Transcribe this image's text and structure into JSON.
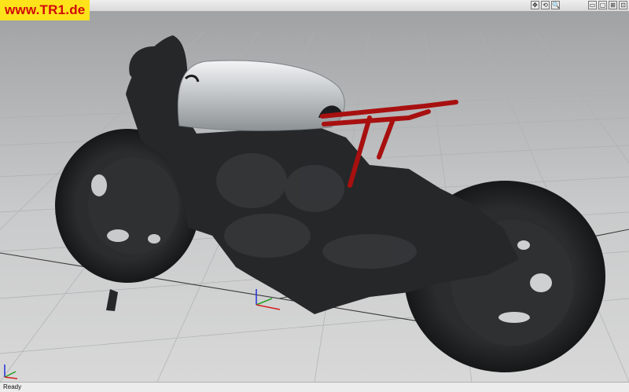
{
  "watermark": {
    "text": "www.TR1.de"
  },
  "toolbar": {
    "view_buttons": [
      {
        "icon": "pan-icon",
        "glyph": "✥"
      },
      {
        "icon": "rotate-icon",
        "glyph": "⟲"
      },
      {
        "icon": "zoom-icon",
        "glyph": "🔍"
      }
    ],
    "window_buttons": [
      {
        "icon": "minimize-icon",
        "glyph": "▭"
      },
      {
        "icon": "restore-icon",
        "glyph": "▢"
      },
      {
        "icon": "expand-icon",
        "glyph": "⊞"
      },
      {
        "icon": "grid-icon",
        "glyph": "⊡"
      }
    ]
  },
  "axis_gizmo": {
    "x_color": "#d42020",
    "y_color": "#22a022",
    "z_color": "#2030d8"
  },
  "statusbar": {
    "text": "Ready"
  },
  "colors": {
    "tank": "#c6cacd",
    "frame": "#b01212",
    "body": "#242628"
  }
}
